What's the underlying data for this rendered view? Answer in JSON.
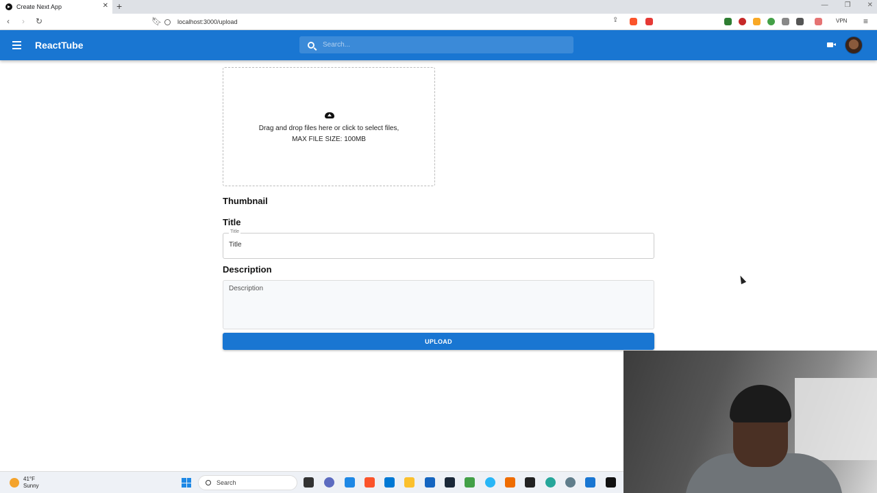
{
  "browser": {
    "tab_title": "Create Next App",
    "url": "localhost:3000/upload",
    "vpn_label": "VPN"
  },
  "appbar": {
    "brand": "ReactTube",
    "search_placeholder": "Search..."
  },
  "upload": {
    "drop_line1": "Drag and drop files here or click to select files,",
    "drop_line2": "MAX FILE SIZE: 100MB",
    "thumbnail_label": "Thumbnail",
    "title_heading": "Title",
    "title_floating": "Title",
    "title_placeholder": "Title",
    "description_heading": "Description",
    "description_placeholder": "Description",
    "upload_button": "UPLOAD"
  },
  "taskbar": {
    "weather_temp": "41°F",
    "weather_desc": "Sunny",
    "search_label": "Search"
  },
  "colors": {
    "primary": "#1976d2"
  }
}
